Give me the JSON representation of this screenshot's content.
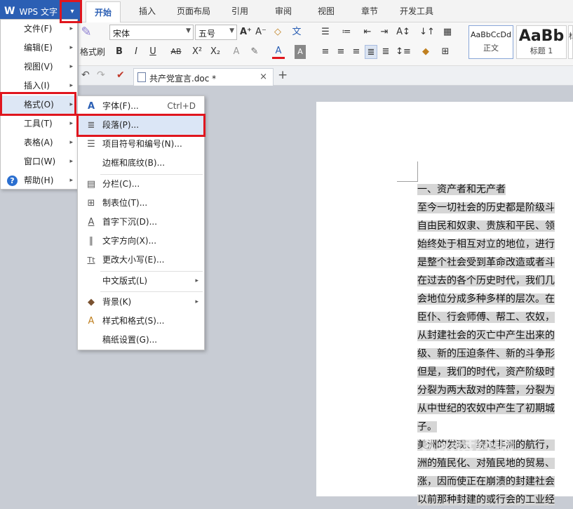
{
  "app": {
    "logo": "W",
    "name": "WPS 文字",
    "dropdown_glyph": "▾"
  },
  "tabs": [
    "开始",
    "插入",
    "页面布局",
    "引用",
    "审阅",
    "视图",
    "章节",
    "开发工具"
  ],
  "ribbon": {
    "font_name": "宋体",
    "font_size": "五号",
    "format_painter_label": "格式刷",
    "bold": "B",
    "italic": "I",
    "underline": "U",
    "strike": "AB",
    "superscript": "X²",
    "subscript": "X₂",
    "font_color_glyph": "A",
    "styles": [
      {
        "preview": "AaBbCcDd",
        "name": "正文"
      },
      {
        "preview": "AaBb",
        "name": "标题 1"
      },
      {
        "preview": "",
        "name": "标"
      }
    ]
  },
  "document": {
    "tab_title": "共产党宣言.doc *",
    "close_glyph": "×",
    "new_tab_glyph": "+",
    "lines": [
      "一、资产者和无产者",
      "至今一切社会的历史都是阶级斗",
      "自由民和奴隶、贵族和平民、领",
      "始终处于相互对立的地位，进行",
      "是整个社会受到革命改造或者斗",
      "在过去的各个历史时代，我们几",
      "会地位分成多种多样的层次。在",
      "臣仆、行会师傅、帮工、农奴，",
      "从封建社会的灭亡中产生出来的",
      "级、新的压迫条件、新的斗争形",
      "但是，我们的时代，资产阶级时",
      "分裂为两大敌对的阵营，分裂为",
      "从中世纪的农奴中产生了初期城",
      "子。",
      "美洲的发现、绕过非洲的航行，",
      "洲的殖民化、对殖民地的贸易、",
      "涨，因而使正在崩溃的封建社会",
      "以前那种封建的或行会的工业经"
    ]
  },
  "main_menu": {
    "items": [
      {
        "label": "文件(F)",
        "has_submenu": true
      },
      {
        "label": "编辑(E)",
        "has_submenu": true
      },
      {
        "label": "视图(V)",
        "has_submenu": true
      },
      {
        "label": "插入(I)",
        "has_submenu": true
      },
      {
        "label": "格式(O)",
        "has_submenu": true
      },
      {
        "label": "工具(T)",
        "has_submenu": true
      },
      {
        "label": "表格(A)",
        "has_submenu": true
      },
      {
        "label": "窗口(W)",
        "has_submenu": true
      },
      {
        "label": "帮助(H)",
        "has_submenu": true
      }
    ],
    "help_glyph": "?",
    "submenu_glyph": "▸"
  },
  "format_submenu": {
    "items": [
      {
        "label": "字体(F)...",
        "shortcut": "Ctrl+D",
        "icon": "A"
      },
      {
        "label": "段落(P)...",
        "shortcut": "",
        "icon": "≣"
      },
      {
        "label": "项目符号和编号(N)...",
        "shortcut": "",
        "icon": "☰"
      },
      {
        "label": "边框和底纹(B)...",
        "shortcut": "",
        "icon": ""
      },
      {
        "label": "分栏(C)...",
        "shortcut": "",
        "icon": "▤"
      },
      {
        "label": "制表位(T)...",
        "shortcut": "",
        "icon": "⊞"
      },
      {
        "label": "首字下沉(D)...",
        "shortcut": "",
        "icon": "A"
      },
      {
        "label": "文字方向(X)...",
        "shortcut": "",
        "icon": "∥"
      },
      {
        "label": "更改大小写(E)...",
        "shortcut": "",
        "icon": "Tt"
      },
      {
        "label": "中文版式(L)",
        "shortcut": "",
        "icon": ""
      },
      {
        "label": "背景(K)",
        "shortcut": "",
        "icon": "◆"
      },
      {
        "label": "样式和格式(S)...",
        "shortcut": "",
        "icon": "A"
      },
      {
        "label": "稿纸设置(G)...",
        "shortcut": "",
        "icon": ""
      }
    ]
  },
  "watermark": {
    "brand": "Bai度经验",
    "url": "jingyan.baidu.com"
  },
  "colors": {
    "accent": "#2b5fb4",
    "highlight_box": "#e0161e",
    "menu_hover": "#dbe6f6"
  }
}
